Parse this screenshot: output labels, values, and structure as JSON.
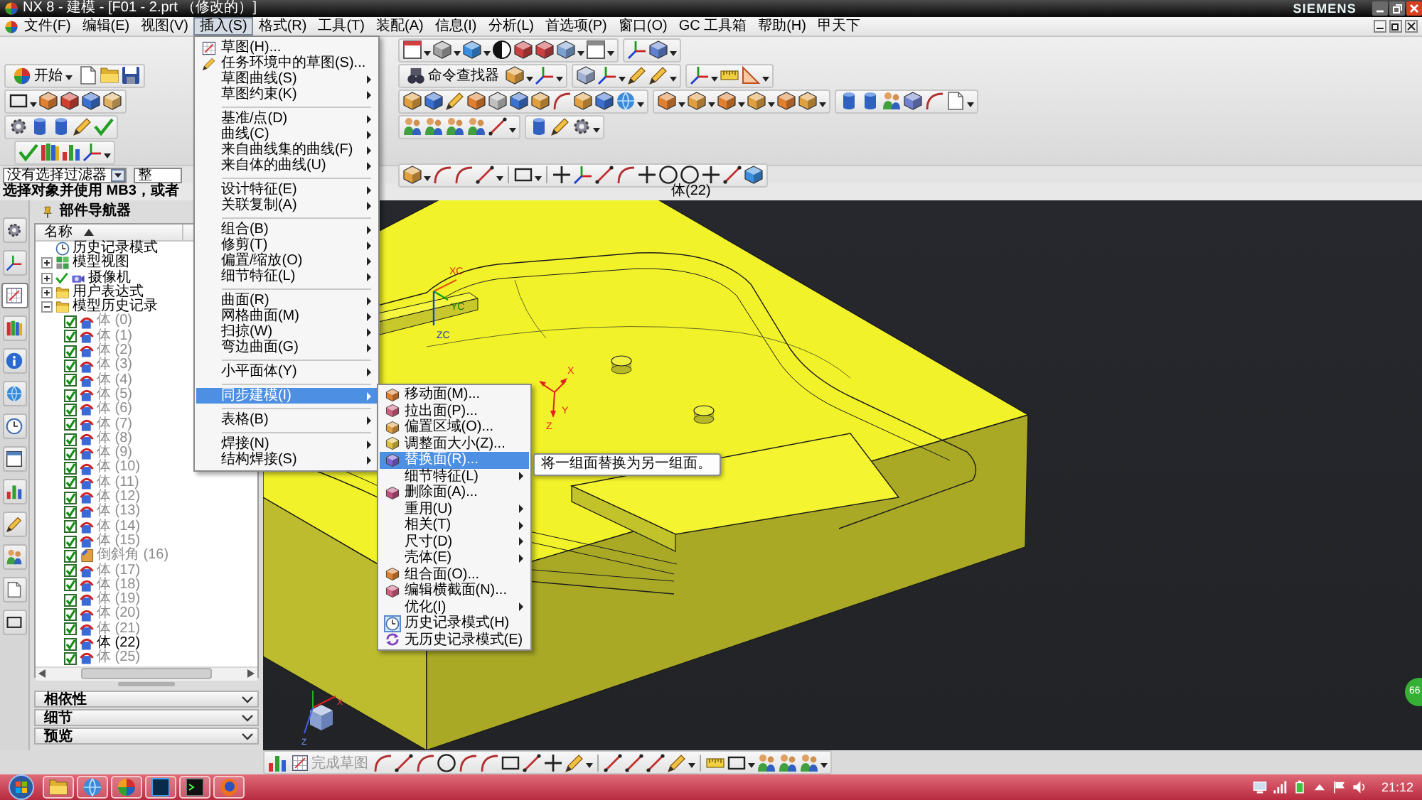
{
  "window": {
    "title": "NX 8 - 建模 - [F01 - 2.prt （修改的）]",
    "brand": "SIEMENS"
  },
  "menu_bar": [
    {
      "label": "文件(F)",
      "selected": false
    },
    {
      "label": "编辑(E)",
      "selected": false
    },
    {
      "label": "视图(V)",
      "selected": false
    },
    {
      "label": "插入(S)",
      "selected": true,
      "items": [
        {
          "kind": "command",
          "label": "草图(H)...",
          "selected": false
        },
        {
          "kind": "command",
          "label": "任务环境中的草图(S)...",
          "selected": false
        },
        {
          "kind": "submenu",
          "label": "草图曲线(S)",
          "selected": false
        },
        {
          "kind": "submenu",
          "label": "草图约束(K)",
          "selected": false
        },
        {
          "kind": "separator"
        },
        {
          "kind": "submenu",
          "label": "基准/点(D)",
          "selected": false
        },
        {
          "kind": "submenu",
          "label": "曲线(C)",
          "selected": false
        },
        {
          "kind": "submenu",
          "label": "来自曲线集的曲线(F)",
          "selected": false
        },
        {
          "kind": "submenu",
          "label": "来自体的曲线(U)",
          "selected": false
        },
        {
          "kind": "separator"
        },
        {
          "kind": "submenu",
          "label": "设计特征(E)",
          "selected": false
        },
        {
          "kind": "submenu",
          "label": "关联复制(A)",
          "selected": false
        },
        {
          "kind": "separator"
        },
        {
          "kind": "submenu",
          "label": "组合(B)",
          "selected": false
        },
        {
          "kind": "submenu",
          "label": "修剪(T)",
          "selected": false
        },
        {
          "kind": "submenu",
          "label": "偏置/缩放(O)",
          "selected": false
        },
        {
          "kind": "submenu",
          "label": "细节特征(L)",
          "selected": false
        },
        {
          "kind": "separator"
        },
        {
          "kind": "submenu",
          "label": "曲面(R)",
          "selected": false
        },
        {
          "kind": "submenu",
          "label": "网格曲面(M)",
          "selected": false
        },
        {
          "kind": "submenu",
          "label": "扫掠(W)",
          "selected": false
        },
        {
          "kind": "submenu",
          "label": "弯边曲面(G)",
          "selected": false
        },
        {
          "kind": "separator"
        },
        {
          "kind": "submenu",
          "label": "小平面体(Y)",
          "selected": false
        },
        {
          "kind": "separator"
        },
        {
          "kind": "submenu",
          "label": "同步建模(I)",
          "selected": true,
          "items": [
            {
              "kind": "command",
              "label": "移动面(M)...",
              "selected": false
            },
            {
              "kind": "command",
              "label": "拉出面(P)...",
              "selected": false
            },
            {
              "kind": "command",
              "label": "偏置区域(O)...",
              "selected": false
            },
            {
              "kind": "command",
              "label": "调整面大小(Z)...",
              "selected": false
            },
            {
              "kind": "command",
              "label": "替换面(R)...",
              "selected": true,
              "tooltip": "将一组面替换为另一组面。"
            },
            {
              "kind": "submenu",
              "label": "细节特征(L)",
              "selected": false
            },
            {
              "kind": "command",
              "label": "删除面(A)...",
              "selected": false
            },
            {
              "kind": "submenu",
              "label": "重用(U)",
              "selected": false
            },
            {
              "kind": "submenu",
              "label": "相关(T)",
              "selected": false
            },
            {
              "kind": "submenu",
              "label": "尺寸(D)",
              "selected": false
            },
            {
              "kind": "submenu",
              "label": "壳体(E)",
              "selected": false
            },
            {
              "kind": "command",
              "label": "组合面(O)...",
              "selected": false
            },
            {
              "kind": "command",
              "label": "编辑横截面(N)...",
              "selected": false
            },
            {
              "kind": "submenu",
              "label": "优化(I)",
              "selected": false
            },
            {
              "kind": "command",
              "label": "历史记录模式(H)",
              "selected": false,
              "checked": true
            },
            {
              "kind": "command",
              "label": "无历史记录模式(E)",
              "selected": false,
              "checked": false
            }
          ]
        },
        {
          "kind": "separator"
        },
        {
          "kind": "submenu",
          "label": "表格(B)",
          "selected": false
        },
        {
          "kind": "separator"
        },
        {
          "kind": "submenu",
          "label": "焊接(N)",
          "selected": false
        },
        {
          "kind": "submenu",
          "label": "结构焊接(S)",
          "selected": false
        }
      ]
    },
    {
      "label": "格式(R)",
      "selected": false
    },
    {
      "label": "工具(T)",
      "selected": false
    },
    {
      "label": "装配(A)",
      "selected": false
    },
    {
      "label": "信息(I)",
      "selected": false
    },
    {
      "label": "分析(L)",
      "selected": false
    },
    {
      "label": "首选项(P)",
      "selected": false
    },
    {
      "label": "窗口(O)",
      "selected": false
    },
    {
      "label": "GC 工具箱",
      "selected": false
    },
    {
      "label": "帮助(H)",
      "selected": false
    },
    {
      "label": "甲天下",
      "selected": false
    }
  ],
  "toolbar": {
    "start_label": "开始",
    "command_finder_label": "命令查找器"
  },
  "selection_bar": {
    "filter": "没有选择过滤器",
    "scope": "整"
  },
  "cue_line": {
    "prompt": "选择对象并使用 MB3，或者",
    "status": "体(22)"
  },
  "resource_bar": [
    {
      "selected": false
    },
    {
      "selected": false
    },
    {
      "selected": true
    },
    {
      "selected": false
    },
    {
      "selected": false
    },
    {
      "selected": false
    },
    {
      "selected": false
    },
    {
      "selected": false
    },
    {
      "selected": false
    },
    {
      "selected": false
    },
    {
      "selected": false
    },
    {
      "selected": false
    },
    {
      "selected": false
    }
  ],
  "part_navigator": {
    "title": "部件导航器",
    "column": "名称",
    "tree": [
      {
        "kind": "history-mode",
        "label": "历史记录模式"
      },
      {
        "kind": "views",
        "label": "模型视图",
        "expanded": false
      },
      {
        "kind": "cameras",
        "label": "摄像机",
        "expanded": false,
        "checked": true
      },
      {
        "kind": "folder",
        "label": "用户表达式",
        "expanded": false
      },
      {
        "kind": "folder",
        "label": "模型历史记录",
        "expanded": true,
        "children": [
          {
            "kind": "body",
            "label": "体 (0)",
            "checked": true,
            "current": false
          },
          {
            "kind": "body",
            "label": "体 (1)",
            "checked": true,
            "current": false
          },
          {
            "kind": "body",
            "label": "体 (2)",
            "checked": true,
            "current": false
          },
          {
            "kind": "body",
            "label": "体 (3)",
            "checked": true,
            "current": false
          },
          {
            "kind": "body",
            "label": "体 (4)",
            "checked": true,
            "current": false
          },
          {
            "kind": "body",
            "label": "体 (5)",
            "checked": true,
            "current": false
          },
          {
            "kind": "body",
            "label": "体 (6)",
            "checked": true,
            "current": false
          },
          {
            "kind": "body",
            "label": "体 (7)",
            "checked": true,
            "current": false
          },
          {
            "kind": "body",
            "label": "体 (8)",
            "checked": true,
            "current": false
          },
          {
            "kind": "body",
            "label": "体 (9)",
            "checked": true,
            "current": false
          },
          {
            "kind": "body",
            "label": "体 (10)",
            "checked": true,
            "current": false
          },
          {
            "kind": "body",
            "label": "体 (11)",
            "checked": true,
            "current": false
          },
          {
            "kind": "body",
            "label": "体 (12)",
            "checked": true,
            "current": false
          },
          {
            "kind": "body",
            "label": "体 (13)",
            "checked": true,
            "current": false
          },
          {
            "kind": "body",
            "label": "体 (14)",
            "checked": true,
            "current": false
          },
          {
            "kind": "body",
            "label": "体 (15)",
            "checked": true,
            "current": false
          },
          {
            "kind": "chamfer",
            "label": "倒斜角 (16)",
            "checked": true,
            "current": false
          },
          {
            "kind": "body",
            "label": "体 (17)",
            "checked": true,
            "current": false
          },
          {
            "kind": "body",
            "label": "体 (18)",
            "checked": true,
            "current": false
          },
          {
            "kind": "body",
            "label": "体 (19)",
            "checked": true,
            "current": false
          },
          {
            "kind": "body",
            "label": "体 (20)",
            "checked": true,
            "current": false
          },
          {
            "kind": "body",
            "label": "体 (21)",
            "checked": true,
            "current": false
          },
          {
            "kind": "body",
            "label": "体 (22)",
            "checked": true,
            "current": true
          },
          {
            "kind": "body",
            "label": "体 (25)",
            "checked": true,
            "current": false
          }
        ]
      }
    ]
  },
  "bottom_panels": [
    {
      "label": "相依性"
    },
    {
      "label": "细节"
    },
    {
      "label": "预览"
    }
  ],
  "graphics": {
    "wcs_labels": [
      "XC",
      "YC",
      "ZC"
    ],
    "datum_labels": [
      "X",
      "Y",
      "Z"
    ],
    "view_triad_labels": [
      "X",
      "Z"
    ],
    "widget": "66"
  },
  "sketch_toolbar": {
    "finish_sketch": {
      "label": "完成草图",
      "disabled": true
    }
  },
  "taskbar": {
    "clock": "21:12"
  }
}
